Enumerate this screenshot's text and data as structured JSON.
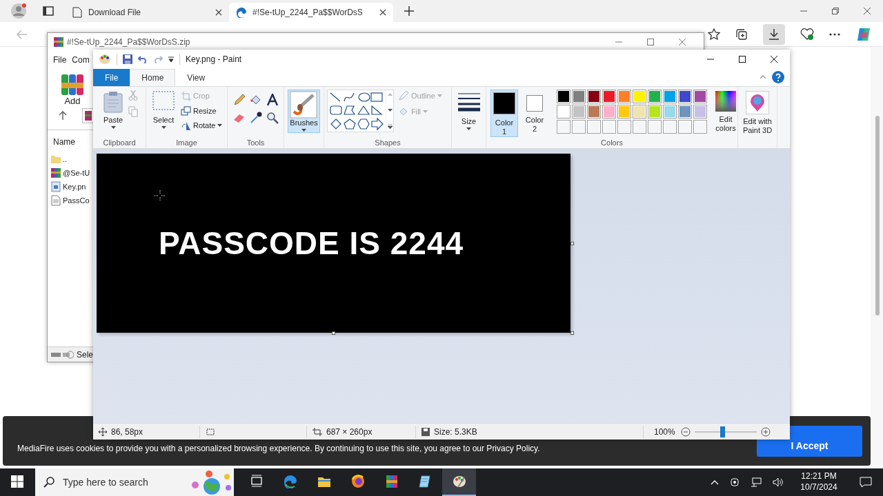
{
  "browser": {
    "tabs": [
      {
        "title": "Download File",
        "kind": "page",
        "selected": false
      },
      {
        "title": "#!Se-tUp_2244_Pa$$WorDsS",
        "kind": "edge",
        "selected": true
      }
    ]
  },
  "cookie_banner": {
    "text": "MediaFire uses cookies to provide you with a personalized browsing experience. By continuing to use this site, you agree to our Privacy Policy.",
    "button": "I Accept"
  },
  "winrar": {
    "title": "#!Se-tUp_2244_Pa$$WorDsS.zip",
    "menu": [
      "File",
      "Com"
    ],
    "toolbar": [
      "Add"
    ],
    "column": "Name",
    "files": [
      {
        "name": "..",
        "kind": "folder"
      },
      {
        "name": "@Se-tU",
        "kind": "archive"
      },
      {
        "name": "Key.pn",
        "kind": "image"
      },
      {
        "name": "PassCo",
        "kind": "text"
      }
    ],
    "status": "Sele"
  },
  "paint": {
    "title": "Key.png - Paint",
    "tabs": [
      {
        "label": "File",
        "kind": "file",
        "selected": false
      },
      {
        "label": "Home",
        "kind": "tab",
        "selected": true
      },
      {
        "label": "View",
        "kind": "tab",
        "selected": false
      }
    ],
    "clipboard": {
      "label": "Clipboard",
      "paste": "Paste"
    },
    "image": {
      "label": "Image",
      "select": "Select",
      "commands": [
        {
          "label": "Crop",
          "kind": "crop",
          "disabled": true
        },
        {
          "label": "Resize",
          "kind": "resize",
          "disabled": false
        },
        {
          "label": "Rotate",
          "kind": "rotate",
          "disabled": false
        }
      ]
    },
    "tools": {
      "label": "Tools"
    },
    "brushes": {
      "button": "Brushes",
      "selected": true
    },
    "shapes": {
      "label": "Shapes",
      "outline": {
        "label": "Outline",
        "disabled": true
      },
      "fill": {
        "label": "Fill",
        "disabled": true
      }
    },
    "size": {
      "button": "Size"
    },
    "colors": {
      "label": "Colors",
      "slots": [
        {
          "label": "Color 1",
          "color": "#000000",
          "selected": true
        },
        {
          "label": "Color 2",
          "color": "#ffffff",
          "selected": false
        }
      ],
      "palette": [
        {
          "color": "#000000"
        },
        {
          "color": "#7f7f7f"
        },
        {
          "color": "#880015"
        },
        {
          "color": "#ed1c24"
        },
        {
          "color": "#ff7f27"
        },
        {
          "color": "#fff200"
        },
        {
          "color": "#22b14c"
        },
        {
          "color": "#00a2e8"
        },
        {
          "color": "#3f48cc"
        },
        {
          "color": "#a349a4"
        },
        {
          "color": "#ffffff"
        },
        {
          "color": "#c3c3c3"
        },
        {
          "color": "#b97a57"
        },
        {
          "color": "#ffaec9"
        },
        {
          "color": "#ffc90e"
        },
        {
          "color": "#efe4b0"
        },
        {
          "color": "#b5e61d"
        },
        {
          "color": "#99d9ea"
        },
        {
          "color": "#7092be"
        },
        {
          "color": "#c8bfe7"
        }
      ],
      "edit": "Edit colors"
    },
    "paint3d": "Edit with Paint 3D",
    "canvas_text": "PASSCODE IS 2244",
    "status": {
      "cursor": "86, 58px",
      "dimensions": "687 × 260px",
      "file_size": "Size: 5.3KB",
      "zoom": "100%",
      "zoom_slider": {
        "level": 0.45
      }
    }
  },
  "taskbar": {
    "search_placeholder": "Type here to search",
    "apps": [
      {
        "kind": "taskview",
        "selected": false
      },
      {
        "kind": "edge",
        "selected": false
      },
      {
        "kind": "folder",
        "selected": false
      },
      {
        "kind": "firefox",
        "selected": false
      },
      {
        "kind": "winrar",
        "selected": false
      },
      {
        "kind": "notepad",
        "selected": false
      },
      {
        "kind": "paint",
        "selected": true
      }
    ],
    "time": "12:21 PM",
    "date": "10/7/2024"
  }
}
